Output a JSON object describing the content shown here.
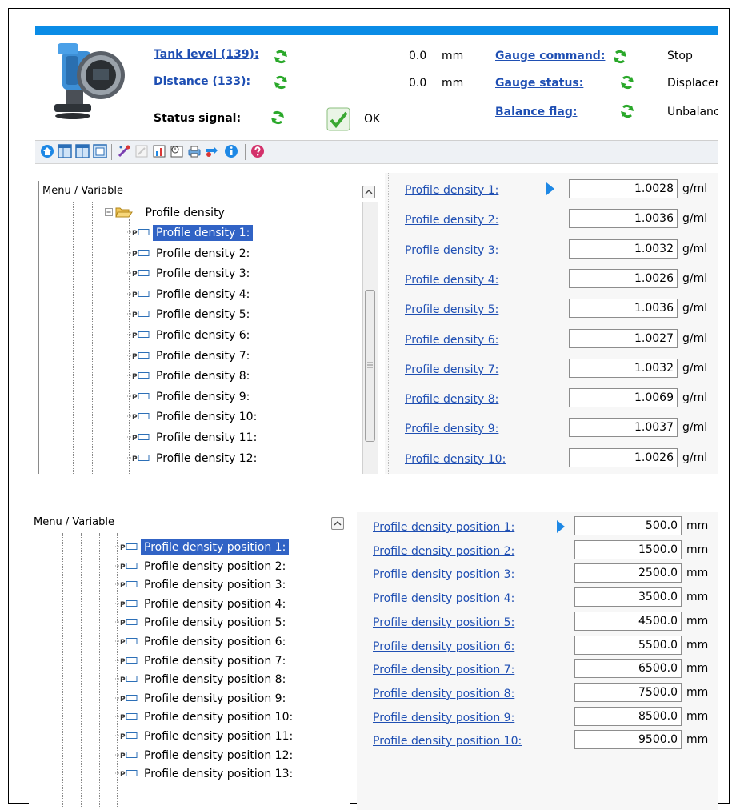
{
  "header": {
    "tank_level_label": "Tank level (139):",
    "tank_level_value": "0.0",
    "tank_level_unit": "mm",
    "distance_label": "Distance (133):",
    "distance_value": "0.0",
    "distance_unit": "mm",
    "status_signal_label": "Status signal:",
    "status_signal_value": "OK",
    "gauge_command_label": "Gauge command:",
    "gauge_command_value": "Stop",
    "gauge_status_label": "Gauge status:",
    "gauge_status_value": "Displacer",
    "balance_flag_label": "Balance flag:",
    "balance_flag_value": "Unbalanc"
  },
  "toolbar": {
    "icons": [
      "home-icon",
      "layout-1-icon",
      "layout-2-icon",
      "layout-3-icon",
      "wizard-icon",
      "edit-icon",
      "chart-icon",
      "clock-icon",
      "print-icon",
      "transfer-icon",
      "info-icon",
      "help-icon"
    ]
  },
  "tree1": {
    "header": "Menu / Variable",
    "folder": "Profile density",
    "items": [
      "Profile density 1:",
      "Profile density 2:",
      "Profile density 3:",
      "Profile density 4:",
      "Profile density 5:",
      "Profile density 6:",
      "Profile density 7:",
      "Profile density 8:",
      "Profile density 9:",
      "Profile density 10:",
      "Profile density 11:",
      "Profile density 12:"
    ],
    "selected_index": 0
  },
  "values1": {
    "rows": [
      {
        "label": "Profile density 1:",
        "value": "1.0028",
        "unit": "g/ml"
      },
      {
        "label": "Profile density 2:",
        "value": "1.0036",
        "unit": "g/ml"
      },
      {
        "label": "Profile density 3:",
        "value": "1.0032",
        "unit": "g/ml"
      },
      {
        "label": "Profile density 4:",
        "value": "1.0026",
        "unit": "g/ml"
      },
      {
        "label": "Profile density 5:",
        "value": "1.0036",
        "unit": "g/ml"
      },
      {
        "label": "Profile density 6:",
        "value": "1.0027",
        "unit": "g/ml"
      },
      {
        "label": "Profile density 7:",
        "value": "1.0032",
        "unit": "g/ml"
      },
      {
        "label": "Profile density 8:",
        "value": "1.0069",
        "unit": "g/ml"
      },
      {
        "label": "Profile density 9:",
        "value": "1.0037",
        "unit": "g/ml"
      },
      {
        "label": "Profile density 10:",
        "value": "1.0026",
        "unit": "g/ml"
      }
    ]
  },
  "tree2": {
    "header": "Menu / Variable",
    "items": [
      "Profile density position 1:",
      "Profile density position 2:",
      "Profile density position 3:",
      "Profile density position 4:",
      "Profile density position 5:",
      "Profile density position 6:",
      "Profile density position 7:",
      "Profile density position 8:",
      "Profile density position 9:",
      "Profile density position 10:",
      "Profile density position 11:",
      "Profile density position 12:",
      "Profile density position 13:"
    ],
    "selected_index": 0
  },
  "values2": {
    "rows": [
      {
        "label": "Profile density position 1:",
        "value": "500.0",
        "unit": "mm"
      },
      {
        "label": "Profile density position 2:",
        "value": "1500.0",
        "unit": "mm"
      },
      {
        "label": "Profile density position 3:",
        "value": "2500.0",
        "unit": "mm"
      },
      {
        "label": "Profile density position 4:",
        "value": "3500.0",
        "unit": "mm"
      },
      {
        "label": "Profile density position 5:",
        "value": "4500.0",
        "unit": "mm"
      },
      {
        "label": "Profile density position 6:",
        "value": "5500.0",
        "unit": "mm"
      },
      {
        "label": "Profile density position 7:",
        "value": "6500.0",
        "unit": "mm"
      },
      {
        "label": "Profile density position 8:",
        "value": "7500.0",
        "unit": "mm"
      },
      {
        "label": "Profile density position 9:",
        "value": "8500.0",
        "unit": "mm"
      },
      {
        "label": "Profile density position 10:",
        "value": "9500.0",
        "unit": "mm"
      }
    ]
  }
}
